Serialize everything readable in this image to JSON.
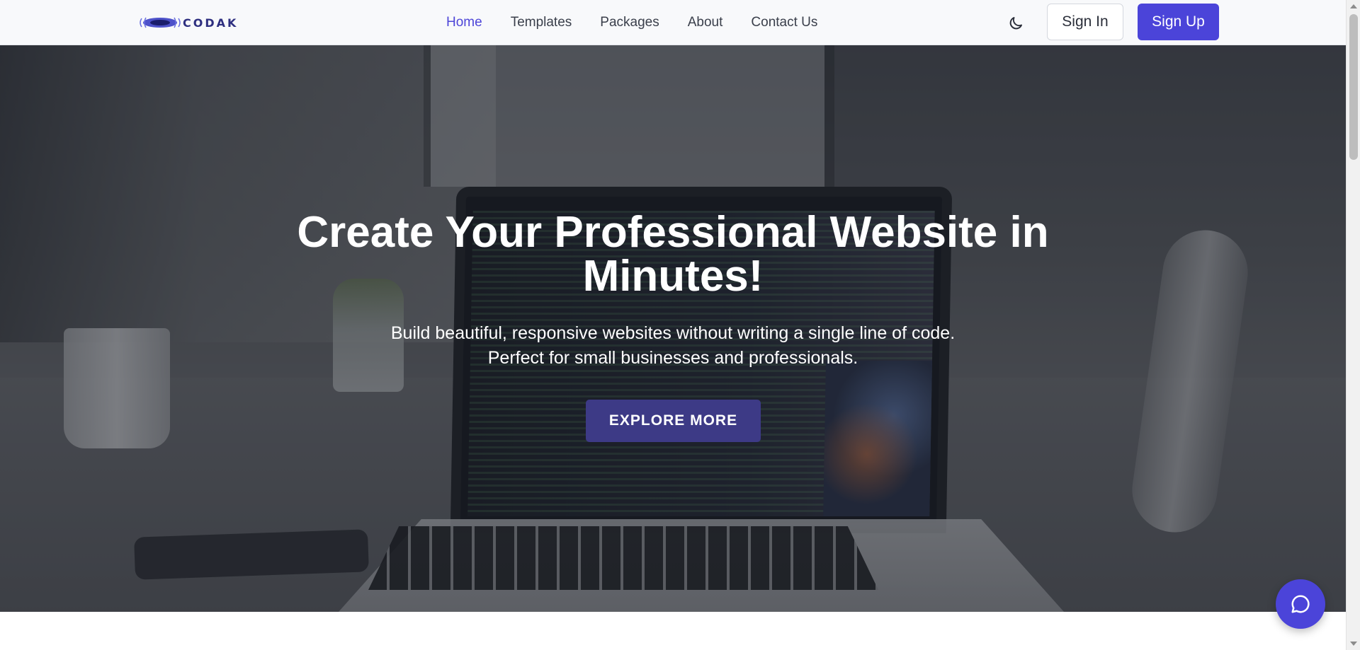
{
  "header": {
    "logo_text": "CODAK",
    "nav": [
      {
        "label": "Home",
        "active": true
      },
      {
        "label": "Templates",
        "active": false
      },
      {
        "label": "Packages",
        "active": false
      },
      {
        "label": "About",
        "active": false
      },
      {
        "label": "Contact Us",
        "active": false
      }
    ],
    "theme_icon": "moon-icon",
    "signin_label": "Sign In",
    "signup_label": "Sign Up"
  },
  "hero": {
    "title": "Create Your Professional Website in Minutes!",
    "subtitle": "Build beautiful, responsive websites without writing a single line of code. Perfect for small businesses and professionals.",
    "cta_label": "EXPLORE MORE"
  },
  "chat": {
    "icon": "chat-bubble-icon"
  },
  "colors": {
    "accent": "#4b44d9",
    "nav_active": "#4e46d8",
    "cta_bg": "#3d3a86",
    "header_bg": "#f8f9fb"
  }
}
